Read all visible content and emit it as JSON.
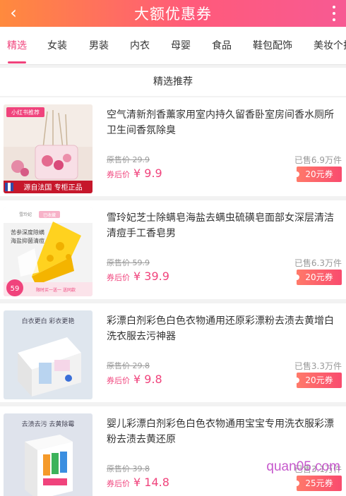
{
  "header": {
    "title": "大额优惠券",
    "back_icon": "back-arrow-icon",
    "more_icon": "more-vertical-icon"
  },
  "tabs": [
    {
      "label": "精选",
      "active": true
    },
    {
      "label": "女装"
    },
    {
      "label": "男装"
    },
    {
      "label": "内衣"
    },
    {
      "label": "母婴"
    },
    {
      "label": "食品"
    },
    {
      "label": "鞋包配饰"
    },
    {
      "label": "美妆个护"
    }
  ],
  "section": {
    "title": "精选推荐"
  },
  "products": [
    {
      "name": "空气清新剂香薰家用室内持久留香卧室房间香水厕所卫生间香氛除臭",
      "orig_label": "原售价",
      "orig_price": "29.9",
      "after_label": "券后价",
      "currency": "¥",
      "after_price": "9.9",
      "sold": "已售6.9万件",
      "coupon": "20元券",
      "thumb": {
        "badge": "小红书推荐",
        "banner": "源自法国 专柜正品"
      }
    },
    {
      "name": "雪玲妃芝士除螨皂海盐去螨虫硫磺皂面部女深层清洁清痘手工香皂男",
      "orig_label": "原售价",
      "orig_price": "59.9",
      "after_label": "券后价",
      "currency": "¥",
      "after_price": "39.9",
      "sold": "已售6.3万件",
      "coupon": "20元券",
      "thumb": {
        "brand": "雪玲妃",
        "tag": "已收藏",
        "text1": "苦参深度除螨",
        "text2": "海盐抑菌清痘",
        "price": "59",
        "buy": "限时买一送一 送同款"
      }
    },
    {
      "name": "彩漂白剂彩色白色衣物通用还原彩漂粉去渍去黄增白洗衣服去污神器",
      "orig_label": "原售价",
      "orig_price": "29.8",
      "after_label": "券后价",
      "currency": "¥",
      "after_price": "9.8",
      "sold": "已售3.3万件",
      "coupon": "20元券",
      "thumb": {
        "text": "白衣更白 彩衣更艳"
      }
    },
    {
      "name": "婴儿彩漂白剂彩色白色衣物通用宝宝专用洗衣服彩漂粉去渍去黄还原",
      "orig_label": "原售价",
      "orig_price": "39.8",
      "after_label": "券后价",
      "currency": "¥",
      "after_price": "14.8",
      "sold": "已售3.1万件",
      "coupon": "25元券",
      "thumb": {
        "text": "去渍去污 去黄除霉"
      }
    }
  ],
  "watermark": "quan05.com"
}
